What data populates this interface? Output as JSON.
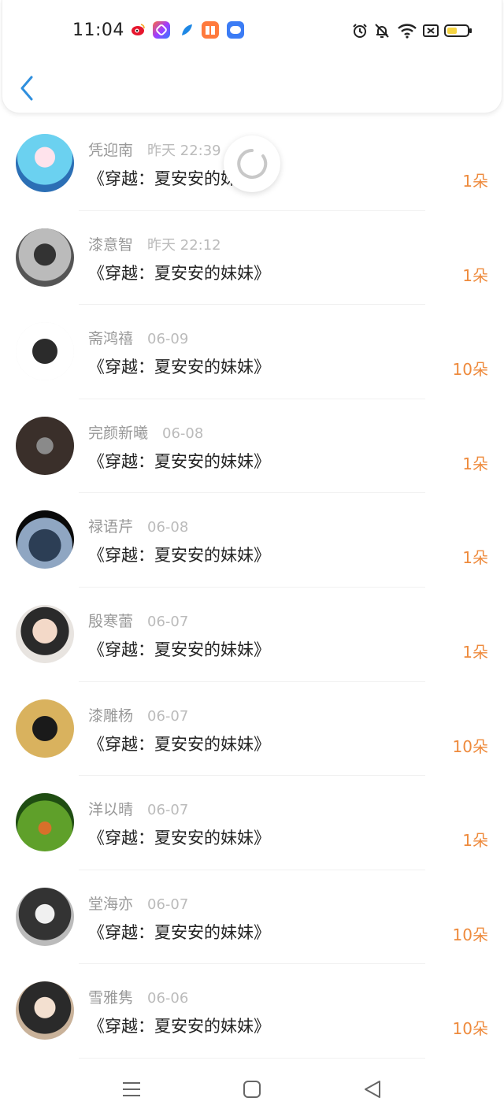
{
  "status_bar": {
    "time": "11:04",
    "app_icons": [
      "weibo-icon",
      "shortcut-app-icon",
      "feather-app-icon",
      "reader-app-icon",
      "chat-app-icon"
    ],
    "system_icons": [
      "alarm-icon",
      "mute-bell-icon",
      "wifi-icon",
      "sim-off-icon",
      "battery-icon"
    ],
    "battery_level": 0.5
  },
  "header": {
    "back_icon": "chevron-left-icon"
  },
  "colors": {
    "accent": "#2f8fde",
    "flower_count": "#ee8a3c",
    "name_text": "#999999",
    "date_text": "#bbbbbb"
  },
  "gifts": [
    {
      "name": "凭迎南",
      "date": "昨天 22:39",
      "book": "《穿越：夏安安的妹妹》",
      "amount": "1朵"
    },
    {
      "name": "漆意智",
      "date": "昨天 22:12",
      "book": "《穿越：夏安安的妹妹》",
      "amount": "1朵"
    },
    {
      "name": "斋鸿禧",
      "date": "06-09",
      "book": "《穿越：夏安安的妹妹》",
      "amount": "10朵"
    },
    {
      "name": "完颜新曦",
      "date": "06-08",
      "book": "《穿越：夏安安的妹妹》",
      "amount": "1朵"
    },
    {
      "name": "禄语芹",
      "date": "06-08",
      "book": "《穿越：夏安安的妹妹》",
      "amount": "1朵"
    },
    {
      "name": "殷寒蕾",
      "date": "06-07",
      "book": "《穿越：夏安安的妹妹》",
      "amount": "1朵"
    },
    {
      "name": "漆雕杨",
      "date": "06-07",
      "book": "《穿越：夏安安的妹妹》",
      "amount": "10朵"
    },
    {
      "name": "洋以晴",
      "date": "06-07",
      "book": "《穿越：夏安安的妹妹》",
      "amount": "1朵"
    },
    {
      "name": "堂海亦",
      "date": "06-07",
      "book": "《穿越：夏安安的妹妹》",
      "amount": "10朵"
    },
    {
      "name": "雪雅隽",
      "date": "06-06",
      "book": "《穿越：夏安安的妹妹》",
      "amount": "10朵"
    }
  ],
  "loading_indicator": "refresh-spinner-icon",
  "nav_bar": {
    "icons": [
      "menu-icon",
      "home-square-icon",
      "back-triangle-icon"
    ]
  }
}
